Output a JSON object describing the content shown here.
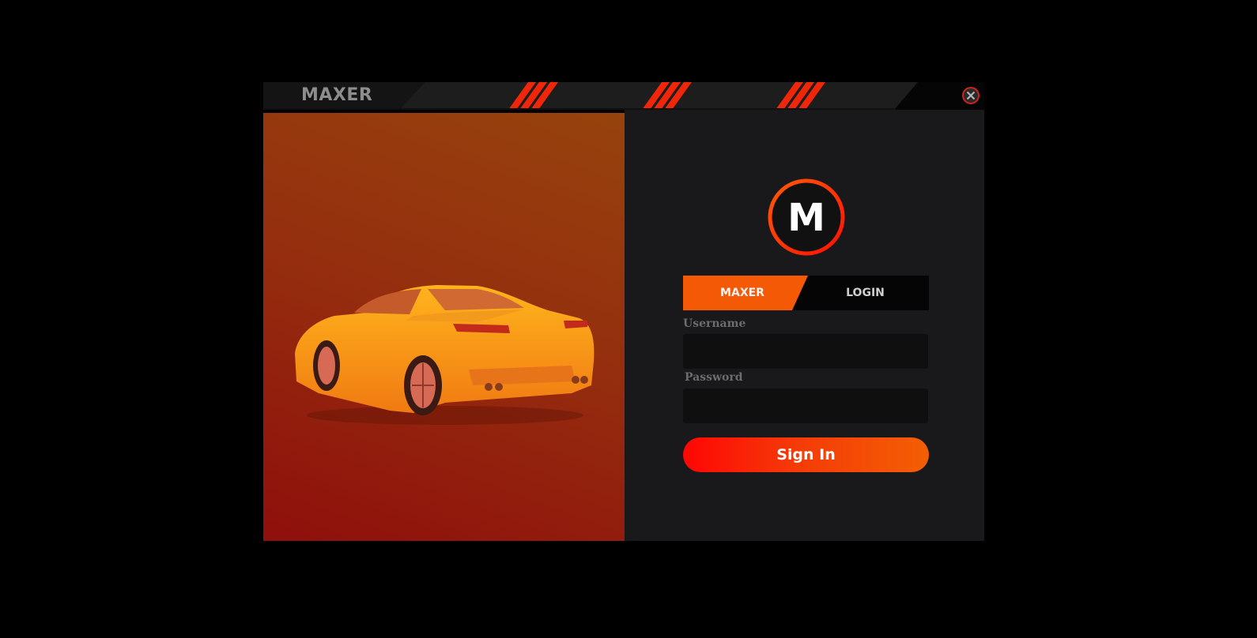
{
  "app": {
    "title": "MAXER"
  },
  "logo": {
    "letter": "M"
  },
  "tabs": [
    {
      "label": "MAXER",
      "active": true
    },
    {
      "label": "LOGIN",
      "active": false
    }
  ],
  "form": {
    "username_label": "Username",
    "username_value": "",
    "password_label": "Password",
    "password_value": "",
    "submit_label": "Sign In"
  },
  "colors": {
    "accent": "#f45a05",
    "accent_red": "#ff0606",
    "panel_dark": "#19191b",
    "background": "#000000"
  },
  "icons": {
    "close": "close-circle-icon"
  }
}
